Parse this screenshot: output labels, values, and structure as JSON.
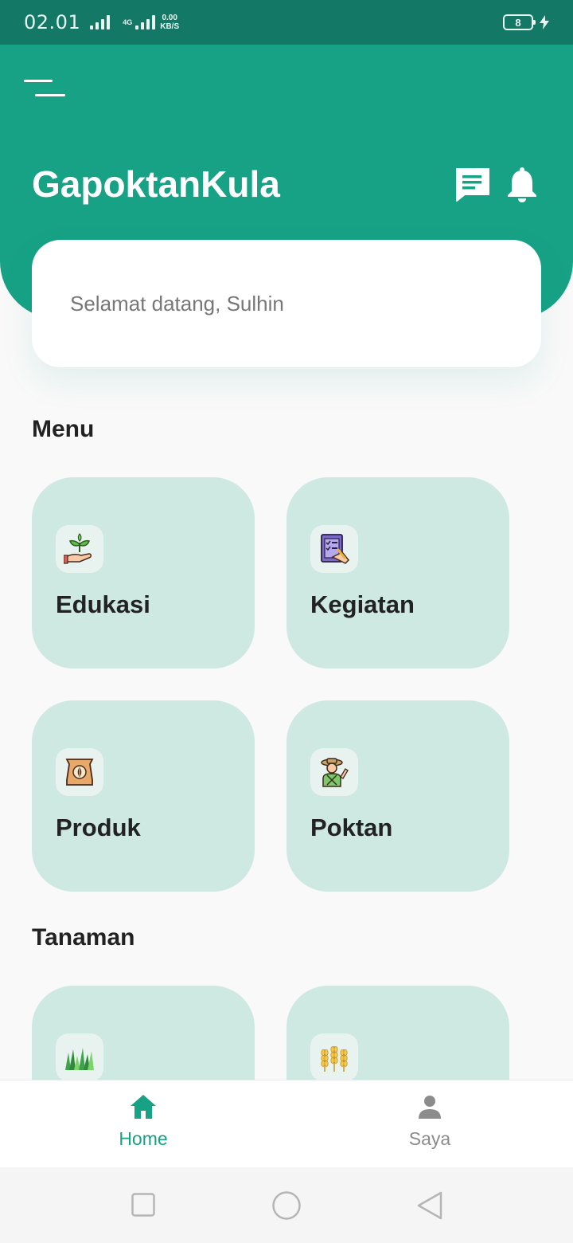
{
  "status_bar": {
    "time": "02.01",
    "network": "4G",
    "speed_value": "0.00",
    "speed_unit": "KB/S",
    "battery": "8"
  },
  "header": {
    "app_title": "GapoktanKula",
    "welcome_text": "Selamat datang, Sulhin",
    "menu_icon": "hamburger-icon",
    "chat_icon": "chat-icon",
    "bell_icon": "bell-icon"
  },
  "sections": {
    "menu_title": "Menu",
    "tanaman_title": "Tanaman"
  },
  "menu_items": [
    {
      "label": "Edukasi",
      "icon": "plant-in-hand-icon"
    },
    {
      "label": "Kegiatan",
      "icon": "clipboard-checklist-icon"
    },
    {
      "label": "Produk",
      "icon": "seed-sack-icon"
    },
    {
      "label": "Poktan",
      "icon": "farmer-icon"
    }
  ],
  "tanaman_items": [
    {
      "icon": "grass-icon"
    },
    {
      "icon": "wheat-icon"
    }
  ],
  "bottom_nav": {
    "home_label": "Home",
    "saya_label": "Saya"
  },
  "colors": {
    "primary": "#17a185",
    "status_bar": "#137865",
    "card_bg": "#cee8e2",
    "nav_active": "#17a185",
    "nav_inactive": "#8c8c8c"
  }
}
